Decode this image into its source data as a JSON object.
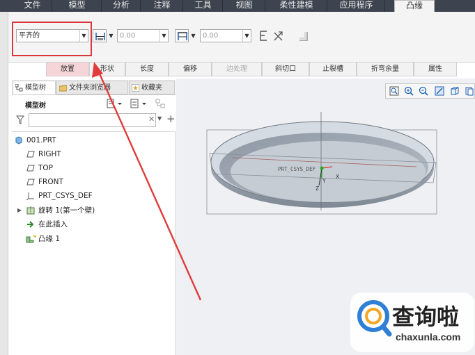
{
  "ribbon_tabs": [
    "文件",
    "模型",
    "分析",
    "注释",
    "工具",
    "视图",
    "柔性建模",
    "应用程序",
    "凸缘"
  ],
  "dashboard": {
    "placement_type": "平齐的",
    "value1": "0.00",
    "value2": "0.00"
  },
  "subtabs": [
    "放置",
    "形状",
    "长度",
    "偏移",
    "边处理",
    "斜切口",
    "止裂槽",
    "折弯余量",
    "属性"
  ],
  "panel_tabs": [
    "模型树",
    "文件夹浏览器",
    "收藏夹"
  ],
  "tree": {
    "title": "模型树",
    "filter_placeholder": "",
    "items": [
      "001.PRT",
      "RIGHT",
      "TOP",
      "FRONT",
      "PRT_CSYS_DEF",
      "旋转 1(第一个壁)",
      "在此插入",
      "凸缘 1"
    ]
  },
  "graphics": {
    "csys_label": "PRT_CSYS_DEF",
    "axis_x": "X",
    "axis_y": "Y",
    "axis_z": "Z"
  },
  "logo": {
    "brand": "查询啦",
    "domain": "chaxunla.com"
  },
  "colors": {
    "menubar": "#3d4450",
    "highlight": "#d9363e",
    "active_subtab": "#f6d5d8",
    "part": "#a9b2bd",
    "logo_blue": "#2f7fd6"
  }
}
